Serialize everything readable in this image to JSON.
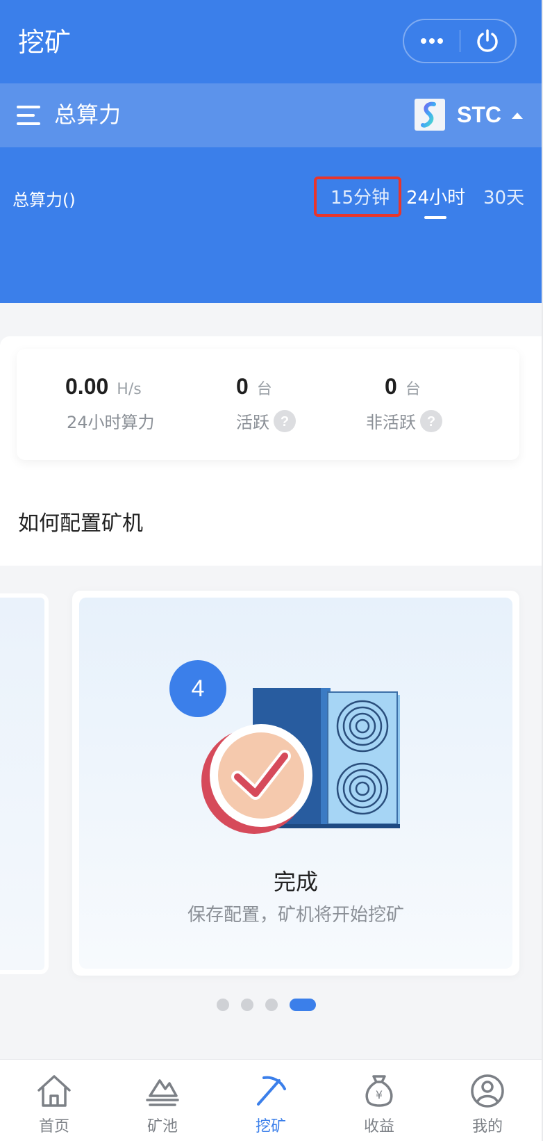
{
  "header": {
    "title": "挖矿",
    "more_icon": "more-dots-icon",
    "power_icon": "power-icon"
  },
  "selector": {
    "title": "总算力",
    "coin_symbol": "STC",
    "menu_icon": "menu-icon",
    "caret_icon": "caret-up-icon"
  },
  "hashrate": {
    "title": "总算力()",
    "ranges": [
      "15分钟",
      "24小时",
      "30天"
    ],
    "active_range": "24小时"
  },
  "stats": [
    {
      "value": "0.00",
      "unit": "H/s",
      "label": "24小时算力"
    },
    {
      "value": "0",
      "unit": "台",
      "label": "活跃"
    },
    {
      "value": "0",
      "unit": "台",
      "label": "非活跃"
    }
  ],
  "guide": {
    "section_title": "如何配置矿机",
    "step_number": "4",
    "step_title": "完成",
    "step_desc": "保存配置，矿机将开始挖矿",
    "total_slides": 4,
    "active_slide": 4
  },
  "tabbar": [
    {
      "label": "首页",
      "icon": "home-icon"
    },
    {
      "label": "矿池",
      "icon": "pool-icon"
    },
    {
      "label": "挖矿",
      "icon": "pickaxe-icon"
    },
    {
      "label": "收益",
      "icon": "money-bag-icon"
    },
    {
      "label": "我的",
      "icon": "user-icon"
    }
  ],
  "colors": {
    "primary": "#3b7fea",
    "selector_bg": "#5c93eb",
    "highlight": "#e8352b"
  }
}
